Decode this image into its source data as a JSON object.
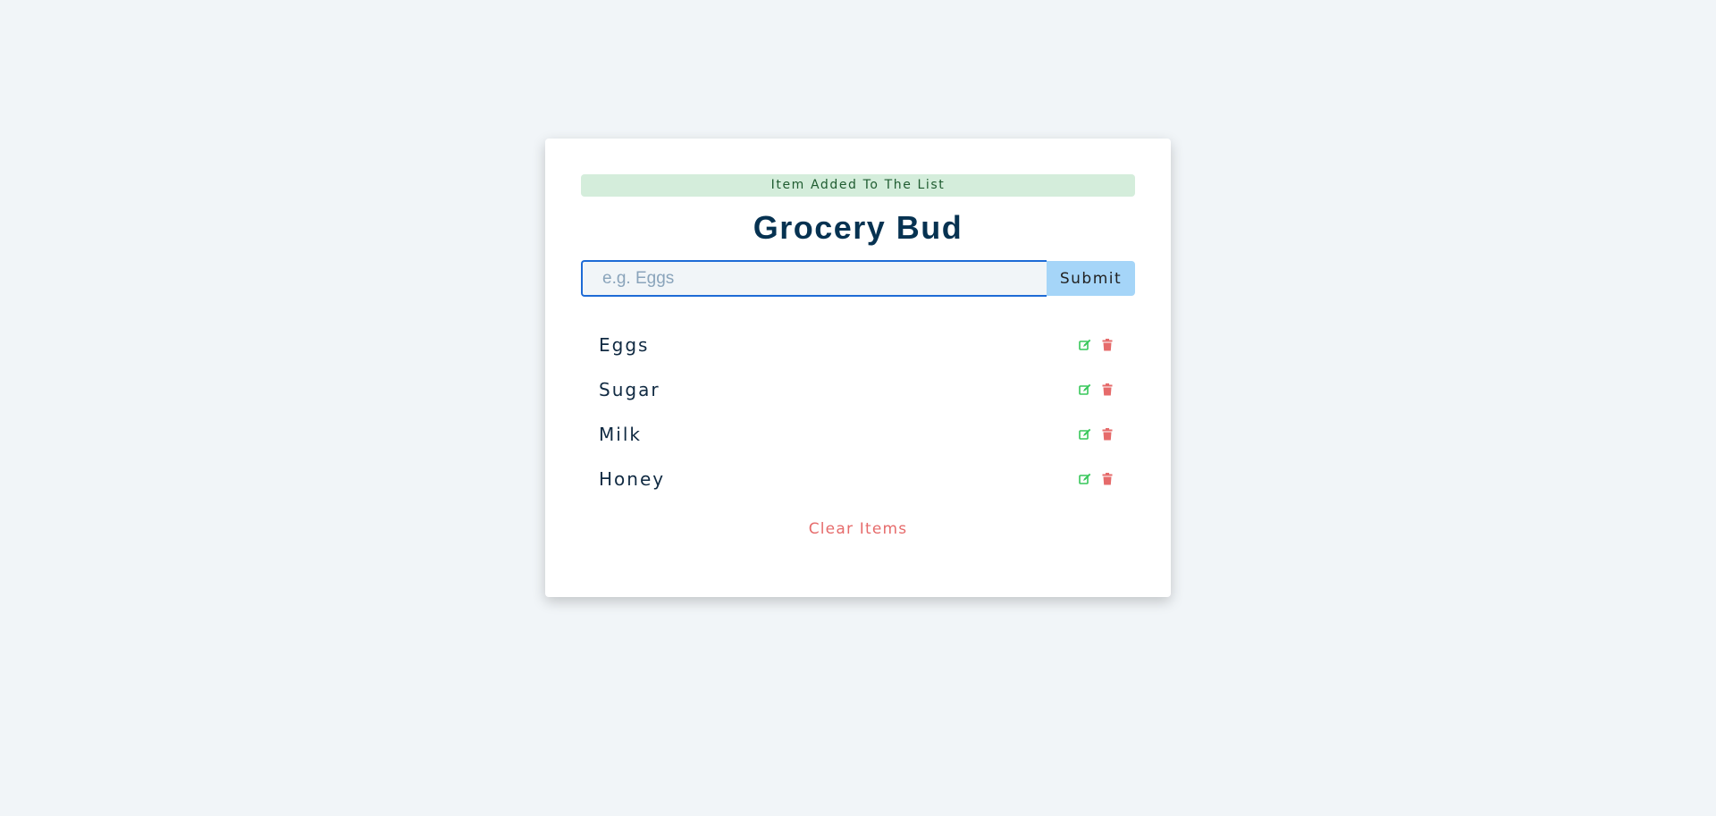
{
  "alert": {
    "text": "Item Added To The List",
    "background": "#d4eddb",
    "color": "#1f5c30"
  },
  "app": {
    "title": "Grocery Bud"
  },
  "form": {
    "placeholder": "e.g. Eggs",
    "value": "",
    "submit_label": "Submit"
  },
  "items": [
    {
      "title": "Eggs",
      "edit_icon": "edit-icon",
      "delete_icon": "trash-icon"
    },
    {
      "title": "Sugar",
      "edit_icon": "edit-icon",
      "delete_icon": "trash-icon"
    },
    {
      "title": "Milk",
      "edit_icon": "edit-icon",
      "delete_icon": "trash-icon"
    },
    {
      "title": "Honey",
      "edit_icon": "edit-icon",
      "delete_icon": "trash-icon"
    }
  ],
  "clear": {
    "label": "Clear Items"
  },
  "colors": {
    "page_background": "#f1f5f8",
    "card_background": "#ffffff",
    "title": "#063251",
    "input_border": "#1e6bd6",
    "submit_background": "#a5d5f8",
    "edit_icon": "#37c75a",
    "delete_icon": "#e66b6b",
    "clear_text": "#e66b6b"
  }
}
